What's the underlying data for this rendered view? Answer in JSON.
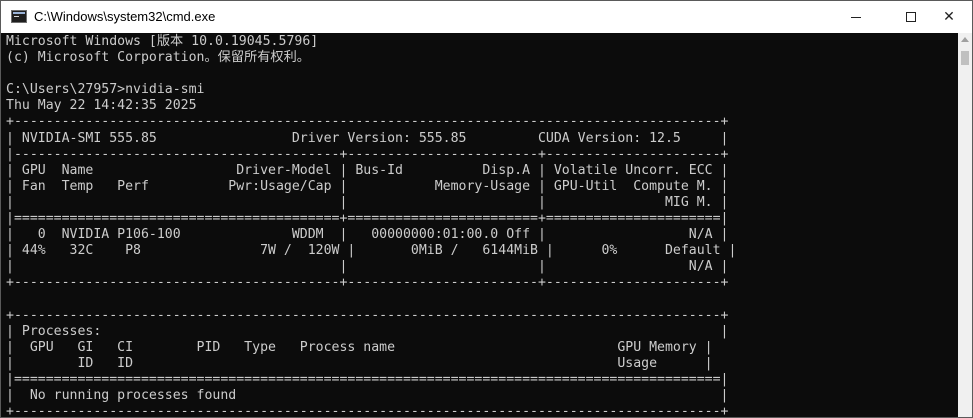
{
  "window": {
    "title": "C:\\Windows\\system32\\cmd.exe",
    "icon": "cmd-icon",
    "controls": [
      "minimize-icon",
      "maximize-icon",
      "close-icon"
    ],
    "close_glyph": "✕"
  },
  "console": {
    "lines": [
      "Microsoft Windows [版本 10.0.19045.5796]",
      "(c) Microsoft Corporation。保留所有权利。",
      "",
      "C:\\Users\\27957>nvidia-smi",
      "Thu May 22 14:42:35 2025",
      "+-----------------------------------------------------------------------------------------+",
      "| NVIDIA-SMI 555.85                 Driver Version: 555.85         CUDA Version: 12.5     |",
      "|-----------------------------------------+------------------------+----------------------+",
      "| GPU  Name                  Driver-Model | Bus-Id          Disp.A | Volatile Uncorr. ECC |",
      "| Fan  Temp   Perf          Pwr:Usage/Cap |           Memory-Usage | GPU-Util  Compute M. |",
      "|                                         |                        |               MIG M. |",
      "|=========================================+========================+======================|",
      "|   0  NVIDIA P106-100              WDDM  |   00000000:01:00.0 Off |                  N/A |",
      "| 44%   32C    P8               7W /  120W |       0MiB /   6144MiB |      0%      Default |",
      "|                                         |                        |                  N/A |",
      "+-----------------------------------------+------------------------+----------------------+",
      "",
      "+-----------------------------------------------------------------------------------------+",
      "| Processes:                                                                              |",
      "|  GPU   GI   CI        PID   Type   Process name                            GPU Memory |",
      "|        ID   ID                                                             Usage      |",
      "|=========================================================================================|",
      "|  No running processes found                                                             |",
      "+-----------------------------------------------------------------------------------------+"
    ]
  },
  "colors": {
    "console_bg": "#0c0c0c",
    "console_fg": "#cccccc",
    "titlebar_bg": "#ffffff"
  }
}
